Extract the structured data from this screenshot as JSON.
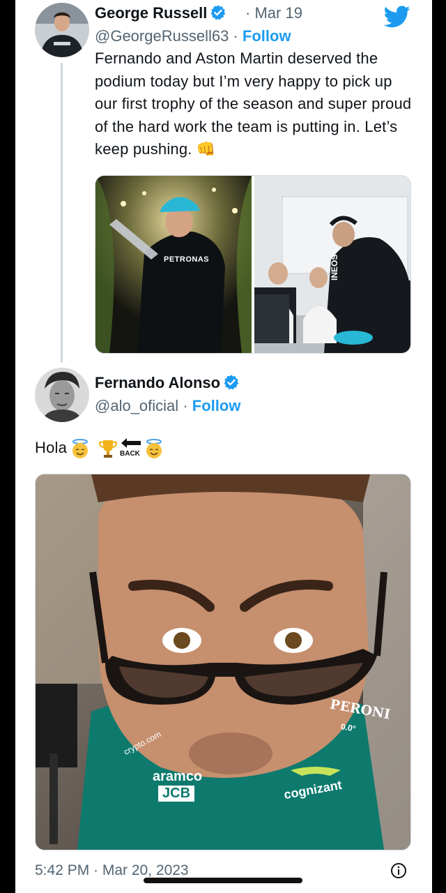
{
  "tweet1": {
    "name": "George Russell",
    "date": "Mar 19",
    "handle": "@GeorgeRussell63",
    "follow_label": "Follow",
    "text": "Fernando and Aston Martin deserved the podium today but I’m very happy to pick up our first trophy of the season and super proud of the hard work the team is putting in. Let’s keep pushing. 👊",
    "photo_left_sponsor": "PETRONAS",
    "photo_right_sponsor": "INEOS"
  },
  "tweet2": {
    "name": "Fernando Alonso",
    "handle": "@alo_oficial",
    "follow_label": "Follow",
    "text": "Hola",
    "back_label": "BACK",
    "photo_sponsors": {
      "peroni": "PERONI",
      "peroni_sub": "0.0°",
      "crypto": "crypto.com",
      "aramco": "aramco",
      "jcb": "JCB",
      "cognizant": "cognizant"
    }
  },
  "footer": {
    "timestamp": "5:42 PM · Mar 20, 2023"
  },
  "colors": {
    "link_blue": "#1d9bf0",
    "text": "#0f1419",
    "grey": "#536471",
    "aston_green": "#0e7a6e"
  },
  "icons": {
    "bird": "twitter-bird-icon",
    "verified": "verified-badge-icon",
    "info": "info-icon"
  }
}
